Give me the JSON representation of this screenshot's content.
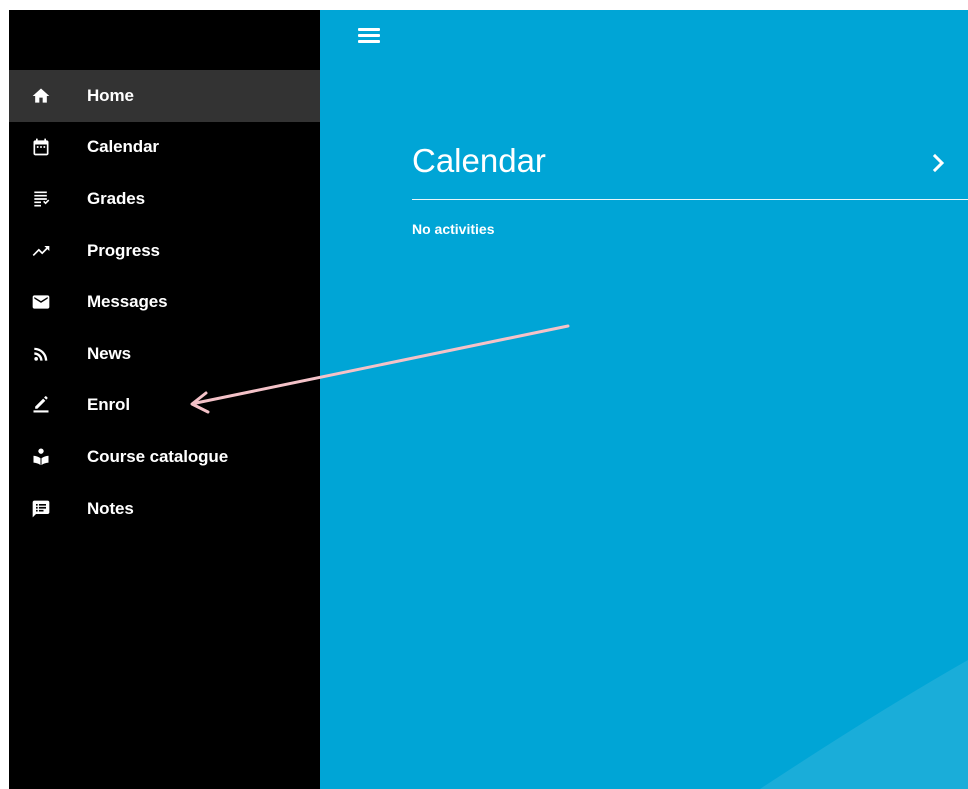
{
  "colors": {
    "sidebar_bg": "#000000",
    "sidebar_active": "#333333",
    "main_bg": "#00a5d6",
    "text": "#ffffff",
    "annotation_arrow": "#f4c2c8"
  },
  "header": {
    "menu_icon": "hamburger-menu-icon"
  },
  "sidebar": {
    "items": [
      {
        "label": "Home",
        "icon": "home-icon",
        "active": true
      },
      {
        "label": "Calendar",
        "icon": "calendar-icon"
      },
      {
        "label": "Grades",
        "icon": "grades-list-icon"
      },
      {
        "label": "Progress",
        "icon": "trending-up-icon"
      },
      {
        "label": "Messages",
        "icon": "mail-icon"
      },
      {
        "label": "News",
        "icon": "rss-icon"
      },
      {
        "label": "Enrol",
        "icon": "pencil-icon"
      },
      {
        "label": "Course catalogue",
        "icon": "reader-icon"
      },
      {
        "label": "Notes",
        "icon": "notes-comment-icon"
      }
    ]
  },
  "calendar": {
    "title": "Calendar",
    "empty_text": "No activities",
    "chevron_icon": "chevron-right-icon"
  }
}
